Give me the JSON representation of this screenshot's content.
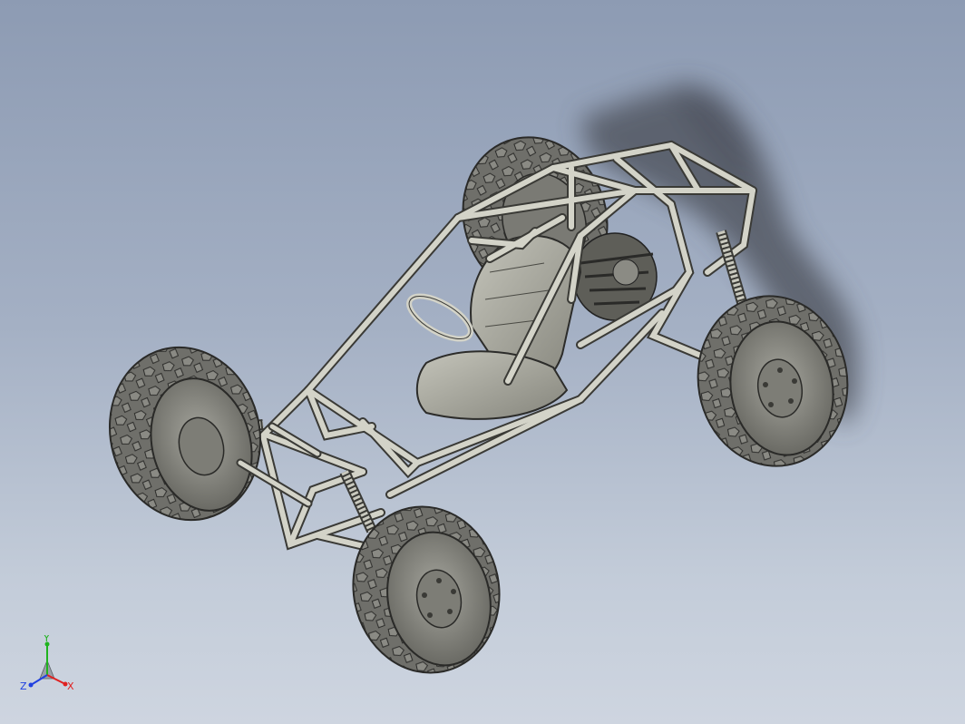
{
  "viewport": {
    "model": "buggy-assembly",
    "background_top": "#8d9bb3",
    "background_bottom": "#ced5e0"
  },
  "triad": {
    "x_label": "X",
    "y_label": "Y",
    "z_label": "Z",
    "x_color": "#e02020",
    "y_color": "#1fb31f",
    "z_color": "#2040e0"
  },
  "colors": {
    "tube": "#d3d3c8",
    "tube_outline": "#3a3a36",
    "tire": "#6f6f6a",
    "rim": "#8d8d86",
    "seat": "#a9a99f",
    "shadow": "#4a4e56"
  }
}
